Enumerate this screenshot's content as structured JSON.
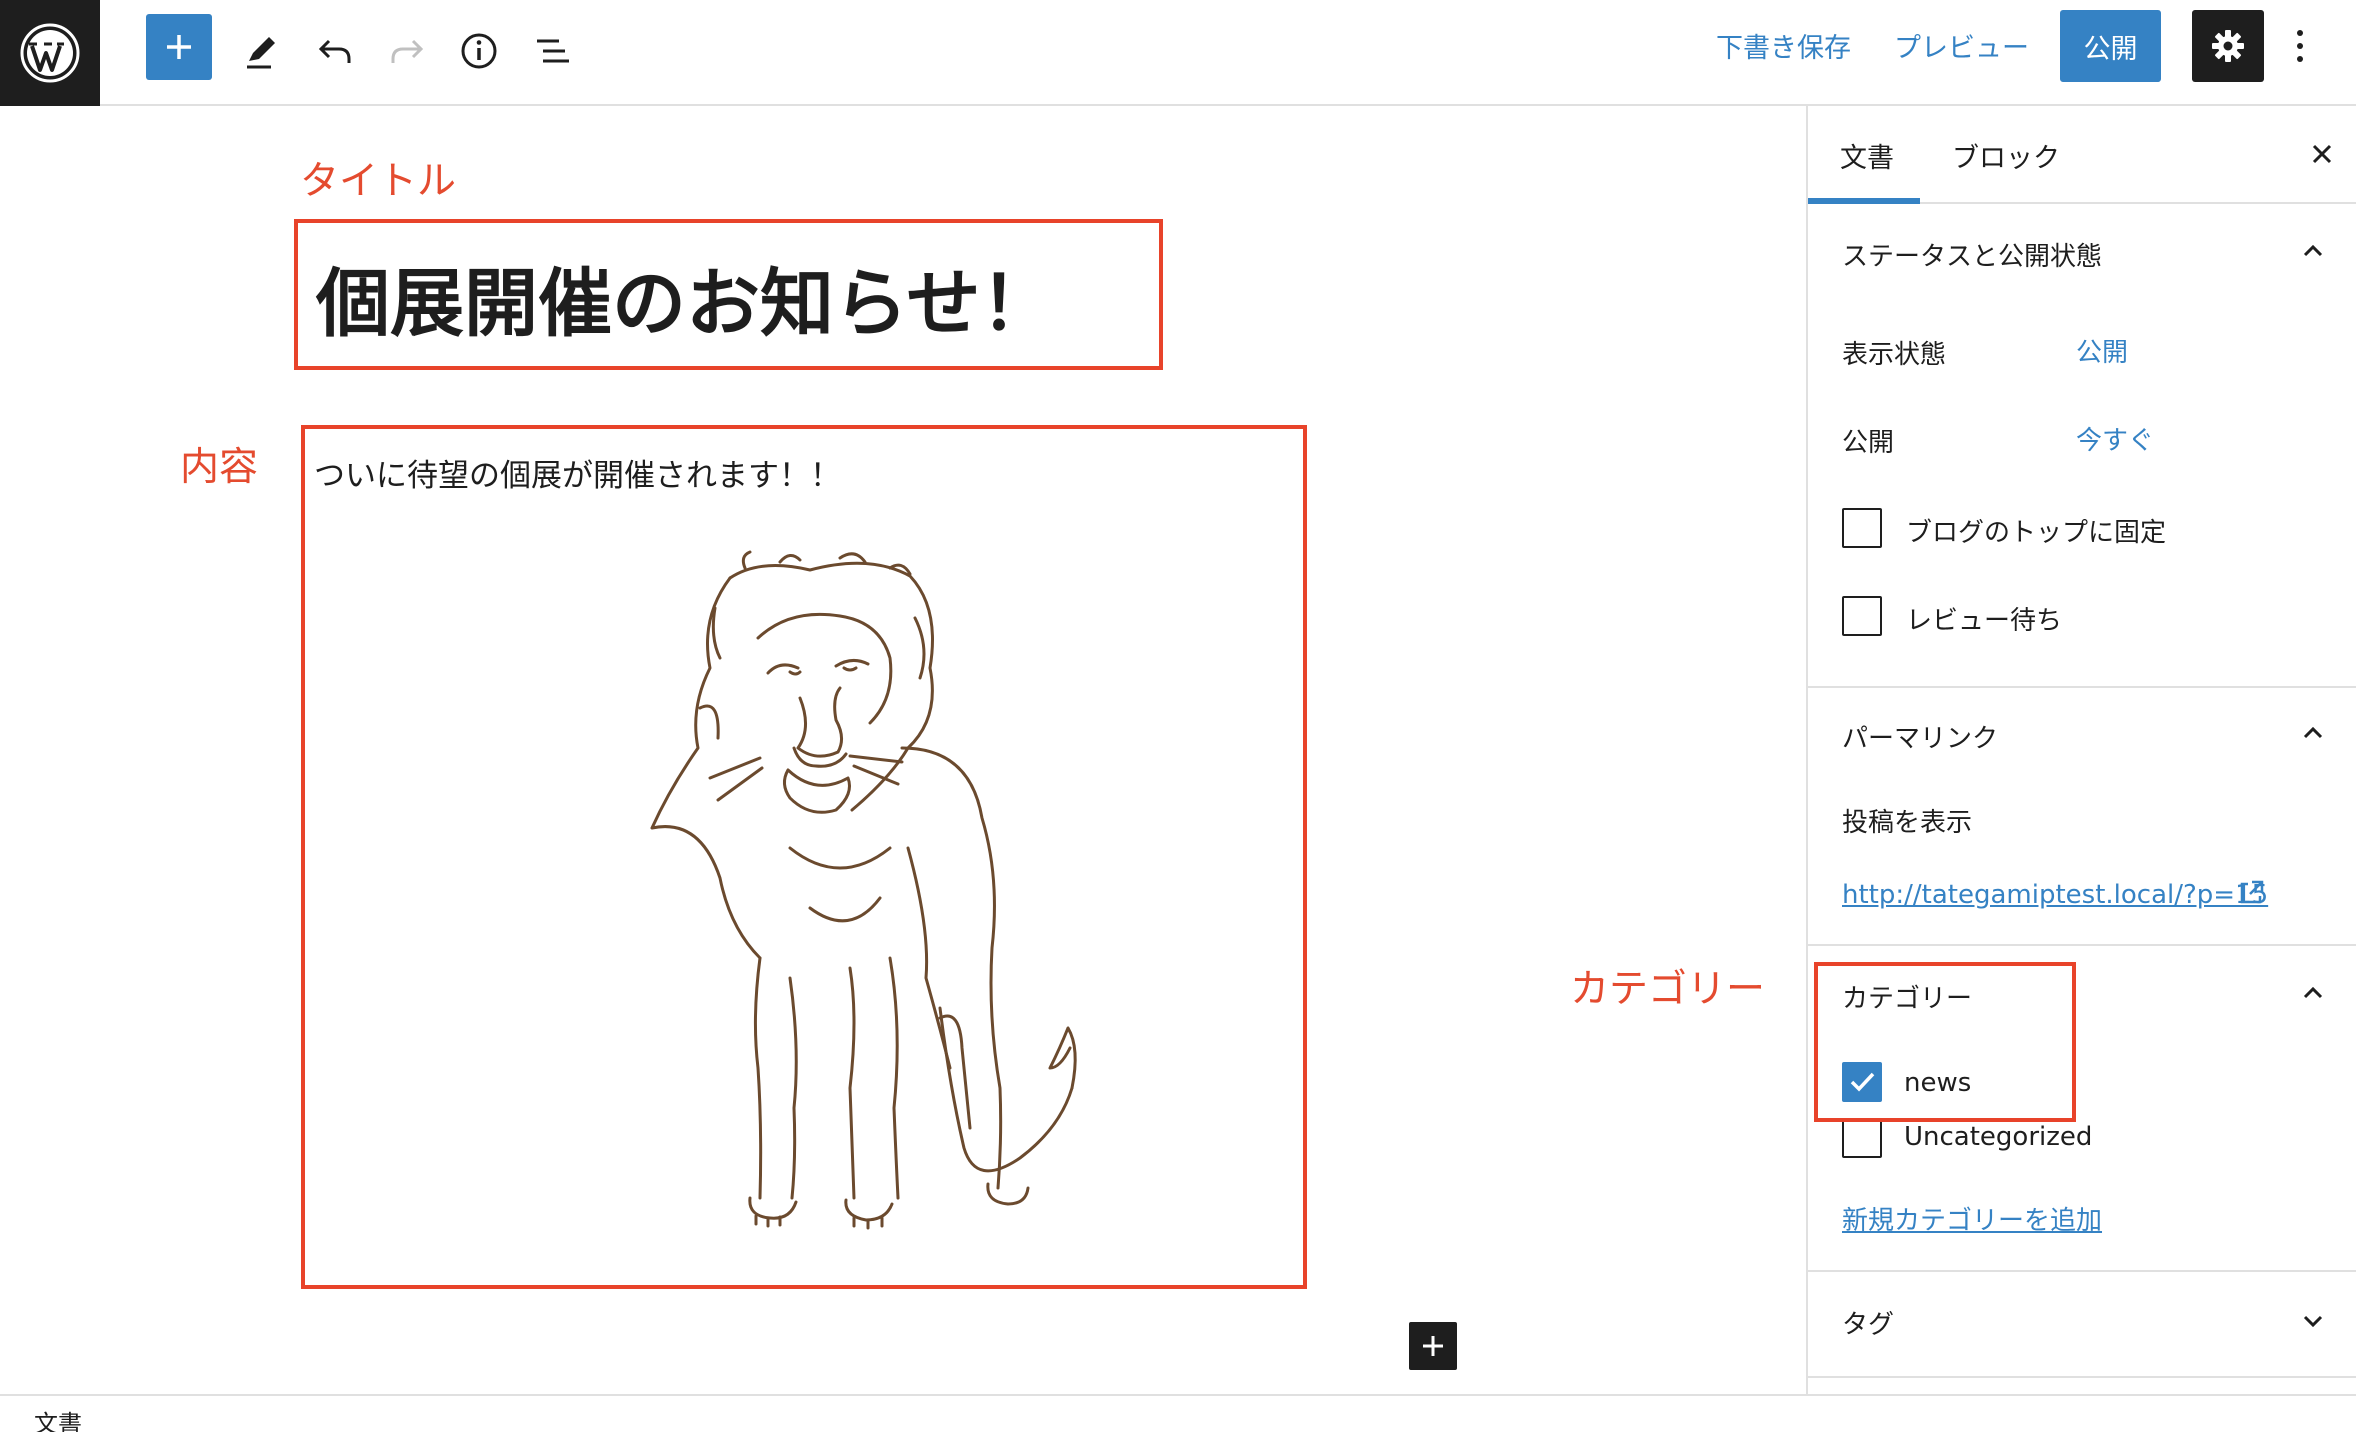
{
  "toolbar": {
    "save_draft_label": "下書き保存",
    "preview_label": "プレビュー",
    "publish_label": "公開",
    "icons": [
      "wordpress-logo-icon",
      "plus-icon",
      "pencil-icon",
      "undo-icon",
      "redo-icon",
      "info-icon",
      "list-view-icon",
      "gear-icon",
      "more-vertical-icon"
    ]
  },
  "editor": {
    "post_title": "個展開催のお知らせ！",
    "paragraph": "ついに待望の個展が開催されます！！",
    "image_subject": "lion-sketch",
    "annotations": {
      "title": "タイトル",
      "content": "内容",
      "category": "カテゴリー"
    },
    "annotation_color": "#e8432a"
  },
  "sidebar": {
    "tabs": [
      {
        "label": "文書",
        "active": true
      },
      {
        "label": "ブロック",
        "active": false
      }
    ],
    "status_panel": {
      "title": "ステータスと公開状態",
      "expanded": true,
      "visibility_label": "表示状態",
      "visibility_value": "公開",
      "publish_label": "公開",
      "publish_value": "今すぐ",
      "checkboxes": [
        {
          "label": "ブログのトップに固定",
          "checked": false
        },
        {
          "label": "レビュー待ち",
          "checked": false
        }
      ]
    },
    "permalink_panel": {
      "title": "パーマリンク",
      "expanded": true,
      "view_post_label": "投稿を表示",
      "url": "http://tategamiptest.local/?p=15"
    },
    "category_panel": {
      "title": "カテゴリー",
      "expanded": true,
      "categories": [
        {
          "label": "news",
          "checked": true
        },
        {
          "label": "Uncategorized",
          "checked": false
        }
      ],
      "add_new_label": "新規カテゴリーを追加"
    },
    "tags_panel": {
      "title": "タグ",
      "expanded": false
    }
  },
  "footer": {
    "breadcrumb": "文書"
  },
  "colors": {
    "accent": "#3582c4",
    "dark": "#1e1e1e",
    "annotation": "#e8432a"
  }
}
